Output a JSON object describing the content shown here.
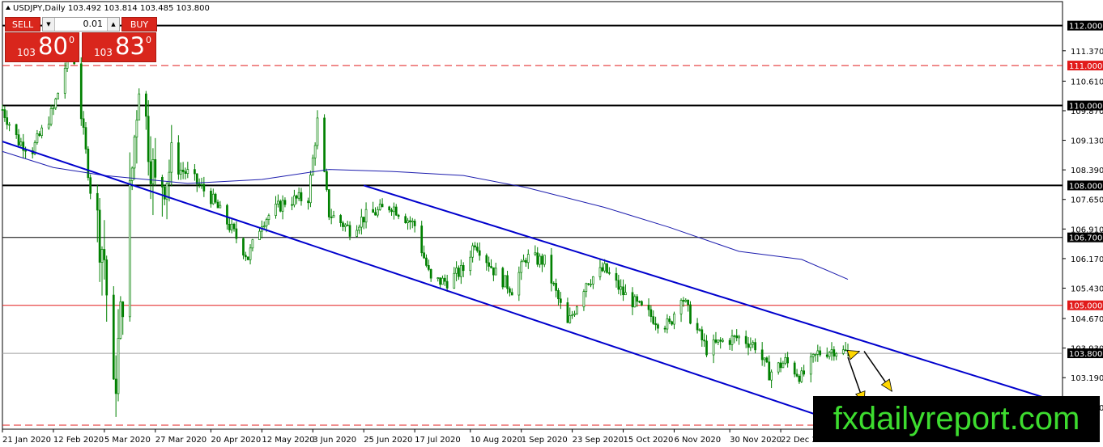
{
  "header": {
    "title": "USDJPY,Daily  103.492 103.814 103.485 103.800"
  },
  "trade_panel": {
    "sell_label": "SELL",
    "buy_label": "BUY",
    "lot_value": "0.01",
    "sell_price": {
      "big_figure": "103",
      "pips": "80",
      "fraction": "0"
    },
    "buy_price": {
      "big_figure": "103",
      "pips": "83",
      "fraction": "0"
    }
  },
  "watermark": "fxdailyreport.com",
  "colors": {
    "candle": "#008000",
    "ma_line": "#1d1dae",
    "channel": "#0000cd",
    "red_level": "#e21b1b",
    "black_level": "#000000",
    "arrow": "#ffd700",
    "panel_red": "#d9261c"
  },
  "chart_data": {
    "type": "candlestick",
    "symbol": "USDJPY",
    "timeframe": "Daily",
    "ohlc_header": {
      "open": 103.492,
      "high": 103.814,
      "low": 103.485,
      "close": 103.8
    },
    "ylim": [
      101.9,
      112.6
    ],
    "x_range": [
      "2020-01-21",
      "2021-01-20"
    ],
    "x_ticks": [
      "21 Jan 2020",
      "12 Feb 2020",
      "5 Mar 2020",
      "27 Mar 2020",
      "20 Apr 2020",
      "12 May 2020",
      "3 Jun 2020",
      "25 Jun 2020",
      "17 Jul 2020",
      "10 Aug 2020",
      "1 Sep 2020",
      "23 Sep 2020",
      "15 Oct 2020",
      "6 Nov 2020",
      "30 Nov 2020",
      "22 Dec 2020"
    ],
    "y_ticks": [
      "111.370",
      "110.610",
      "109.870",
      "109.130",
      "108.390",
      "107.650",
      "106.910",
      "106.170",
      "105.430",
      "104.670",
      "103.930",
      "103.190",
      "102.450"
    ],
    "level_labels": [
      {
        "label": "112.000",
        "value": 112.0,
        "style": "solid",
        "color": "black"
      },
      {
        "label": "111.000",
        "value": 111.0,
        "style": "dashed",
        "color": "red"
      },
      {
        "label": "110.000",
        "value": 110.0,
        "style": "solid",
        "color": "black"
      },
      {
        "label": "108.000",
        "value": 108.0,
        "style": "solid",
        "color": "black"
      },
      {
        "label": "106.700",
        "value": 106.7,
        "style": "solid-thin",
        "color": "black"
      },
      {
        "label": "105.000",
        "value": 105.0,
        "style": "solid-thin",
        "color": "red"
      },
      {
        "label": "103.800",
        "value": 103.8,
        "style": "bid",
        "color": "gray"
      },
      {
        "label": "",
        "value": 102.0,
        "style": "dashed",
        "color": "red"
      }
    ],
    "close_series_anchors": [
      [
        "2020-01-21",
        109.9
      ],
      [
        "2020-01-28",
        109.1
      ],
      [
        "2020-02-03",
        108.9
      ],
      [
        "2020-02-12",
        109.9
      ],
      [
        "2020-02-20",
        111.6
      ],
      [
        "2020-02-28",
        107.9
      ],
      [
        "2020-03-05",
        106.2
      ],
      [
        "2020-03-09",
        102.6
      ],
      [
        "2020-03-13",
        105.3
      ],
      [
        "2020-03-20",
        110.8
      ],
      [
        "2020-03-27",
        107.9
      ],
      [
        "2020-04-03",
        108.5
      ],
      [
        "2020-04-10",
        108.3
      ],
      [
        "2020-04-20",
        107.7
      ],
      [
        "2020-04-30",
        106.8
      ],
      [
        "2020-05-06",
        106.2
      ],
      [
        "2020-05-12",
        107.1
      ],
      [
        "2020-05-22",
        107.6
      ],
      [
        "2020-06-01",
        107.7
      ],
      [
        "2020-06-05",
        109.6
      ],
      [
        "2020-06-10",
        107.3
      ],
      [
        "2020-06-19",
        106.9
      ],
      [
        "2020-06-25",
        107.2
      ],
      [
        "2020-07-07",
        107.5
      ],
      [
        "2020-07-17",
        107.0
      ],
      [
        "2020-07-24",
        105.6
      ],
      [
        "2020-07-31",
        105.6
      ],
      [
        "2020-08-07",
        105.9
      ],
      [
        "2020-08-12",
        106.6
      ],
      [
        "2020-08-21",
        105.8
      ],
      [
        "2020-08-28",
        105.4
      ],
      [
        "2020-09-03",
        106.2
      ],
      [
        "2020-09-11",
        106.1
      ],
      [
        "2020-09-21",
        104.5
      ],
      [
        "2020-09-29",
        105.6
      ],
      [
        "2020-10-07",
        105.9
      ],
      [
        "2020-10-15",
        105.3
      ],
      [
        "2020-10-23",
        104.9
      ],
      [
        "2020-10-30",
        104.6
      ],
      [
        "2020-11-04",
        104.5
      ],
      [
        "2020-11-09",
        105.3
      ],
      [
        "2020-11-13",
        104.7
      ],
      [
        "2020-11-20",
        103.9
      ],
      [
        "2020-11-27",
        104.1
      ],
      [
        "2020-12-04",
        104.2
      ],
      [
        "2020-12-11",
        104.0
      ],
      [
        "2020-12-17",
        103.3
      ],
      [
        "2020-12-24",
        103.6
      ],
      [
        "2020-12-31",
        103.2
      ],
      [
        "2021-01-07",
        103.8
      ],
      [
        "2021-01-14",
        103.9
      ],
      [
        "2021-01-20",
        103.8
      ]
    ],
    "ma_anchors": [
      [
        "2020-01-21",
        108.85
      ],
      [
        "2020-02-12",
        108.45
      ],
      [
        "2020-03-05",
        108.25
      ],
      [
        "2020-04-10",
        108.05
      ],
      [
        "2020-05-12",
        108.15
      ],
      [
        "2020-06-10",
        108.4
      ],
      [
        "2020-07-07",
        108.35
      ],
      [
        "2020-08-07",
        108.25
      ],
      [
        "2020-09-03",
        107.95
      ],
      [
        "2020-10-07",
        107.45
      ],
      [
        "2020-11-04",
        106.95
      ],
      [
        "2020-12-04",
        106.35
      ],
      [
        "2020-12-31",
        106.15
      ],
      [
        "2021-01-20",
        105.65
      ]
    ],
    "channel": {
      "upper": [
        [
          "2020-06-25",
          108.0
        ],
        [
          "2021-04-20",
          102.6
        ]
      ],
      "lower": [
        [
          "2020-01-21",
          109.1
        ],
        [
          "2021-01-20",
          102.0
        ]
      ]
    },
    "forecast_arrows": [
      {
        "from": [
          "2021-01-20",
          103.75
        ],
        "to": [
          "2021-01-25",
          103.85
        ]
      },
      {
        "from": [
          "2021-01-20",
          103.7
        ],
        "to": [
          "2021-01-27",
          102.55
        ]
      },
      {
        "from": [
          "2021-01-27",
          103.85
        ],
        "to": [
          "2021-02-08",
          102.85
        ]
      }
    ]
  }
}
